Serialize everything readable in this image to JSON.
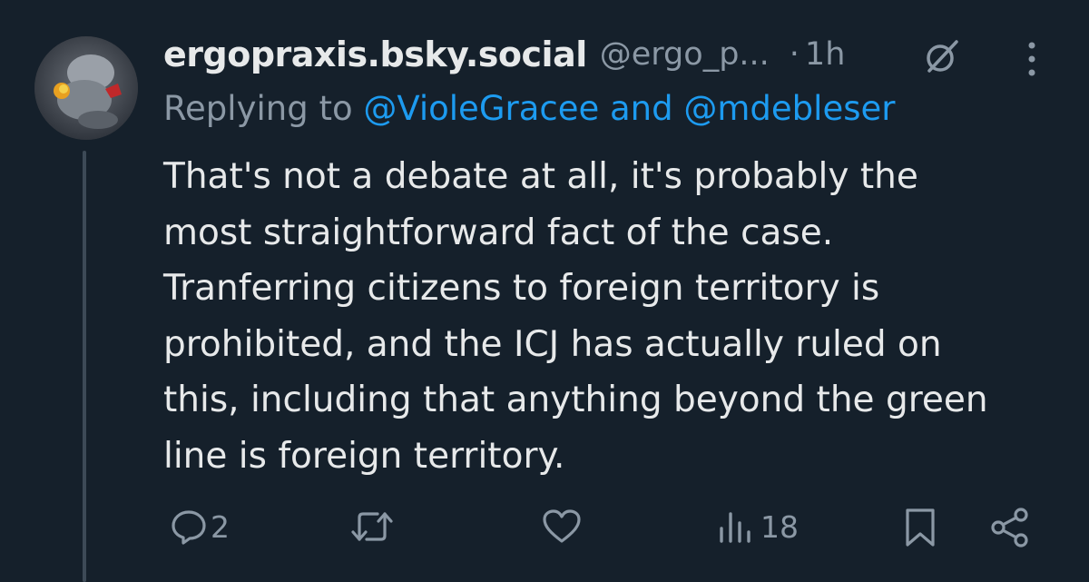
{
  "post": {
    "display_name": "ergopraxis.bsky.social",
    "handle": "@ergo_p...",
    "separator": "·",
    "time": "1h",
    "replying_prefix": "Replying to ",
    "mention_1": "@VioleGracee",
    "mention_joiner": " and ",
    "mention_2": "@mdebleser",
    "text": "That's not a debate at all, it's probably the\nmost straightforward fact of the case.\nTranferring citizens to foreign territory is\nprohibited, and the ICJ has actually ruled on\nthis, including that anything beyond the green\nline is foreign territory."
  },
  "actions": {
    "reply_count": "2",
    "retweet_count": "",
    "views_count": "18"
  },
  "colors": {
    "background": "#15202b",
    "text_primary": "#e7e9ea",
    "text_secondary": "#8b98a5",
    "accent": "#1d9bf0",
    "thread_line": "#3d4a57"
  },
  "icons": [
    "reply-icon",
    "retweet-icon",
    "like-icon",
    "views-icon",
    "bookmark-icon",
    "share-icon",
    "source-icon",
    "more-icon"
  ]
}
